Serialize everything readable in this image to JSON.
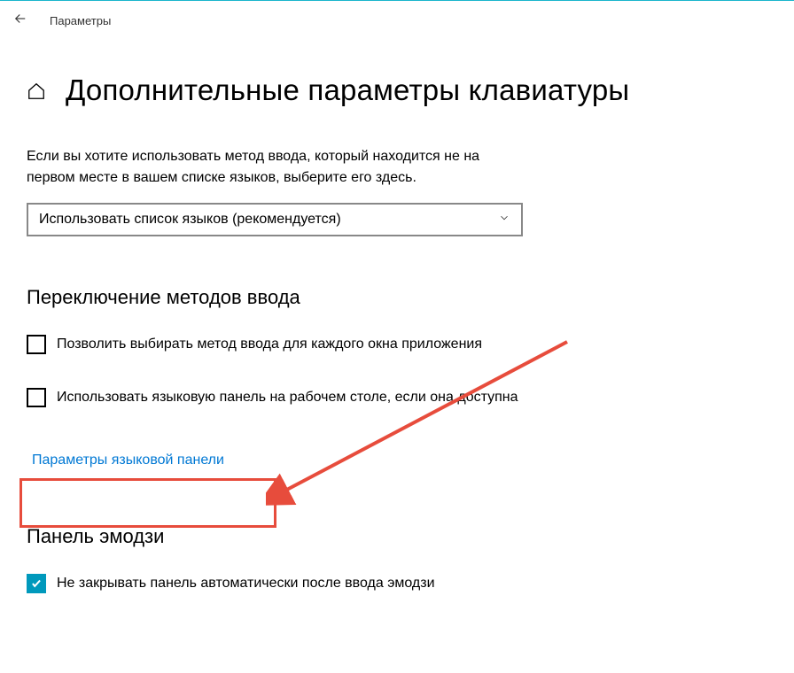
{
  "titlebar": {
    "window_title": "Параметры"
  },
  "header": {
    "page_title": "Дополнительные параметры клавиатуры"
  },
  "intro": {
    "description": "Если вы хотите использовать метод ввода, который находится не на первом месте в вашем списке языков, выберите его здесь."
  },
  "dropdown": {
    "selected": "Использовать список языков (рекомендуется)"
  },
  "section_input": {
    "title": "Переключение методов ввода",
    "checkbox1_label": "Позволить выбирать метод ввода для каждого окна приложения",
    "checkbox1_checked": false,
    "checkbox2_label": "Использовать языковую панель на рабочем столе, если она доступна",
    "checkbox2_checked": false,
    "link_label": "Параметры языковой панели"
  },
  "section_emoji": {
    "title": "Панель эмодзи",
    "checkbox_label": "Не закрывать панель автоматически после ввода эмодзи",
    "checkbox_checked": true
  },
  "annotation": {
    "color": "#e74c3c"
  }
}
